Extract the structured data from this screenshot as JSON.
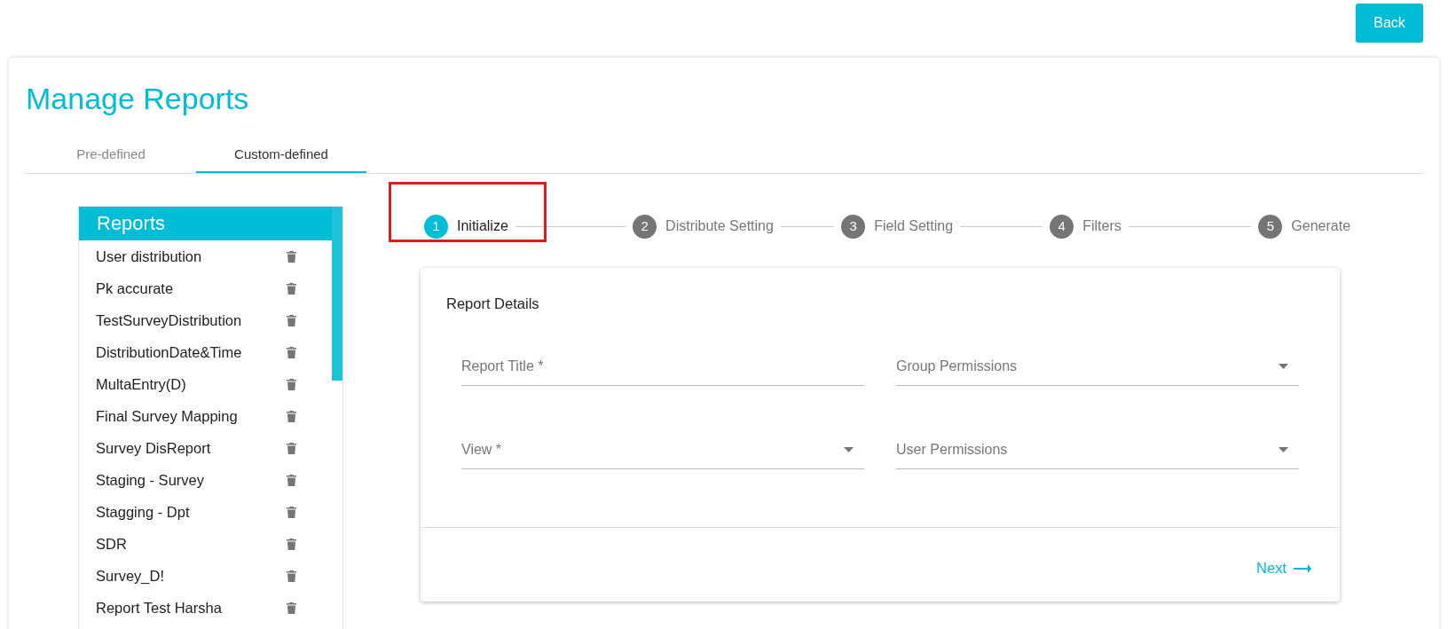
{
  "back_button": "Back",
  "title": "Manage Reports",
  "tabs": [
    {
      "label": "Pre-defined",
      "selected": false
    },
    {
      "label": "Custom-defined",
      "selected": true
    }
  ],
  "reports": {
    "header": "Reports",
    "items": [
      {
        "name": "User distribution"
      },
      {
        "name": "Pk accurate"
      },
      {
        "name": "TestSurveyDistribution"
      },
      {
        "name": "DistributionDate&Time"
      },
      {
        "name": "MultaEntry(D)"
      },
      {
        "name": "Final Survey Mapping"
      },
      {
        "name": "Survey DisReport"
      },
      {
        "name": "Staging - Survey"
      },
      {
        "name": "Stagging - Dpt"
      },
      {
        "name": "SDR"
      },
      {
        "name": "Survey_D!"
      },
      {
        "name": "Report Test Harsha"
      }
    ]
  },
  "steps": [
    {
      "number": "1",
      "label": "Initialize",
      "selected": true,
      "highlighted": true
    },
    {
      "number": "2",
      "label": "Distribute Setting",
      "selected": false,
      "highlighted": false
    },
    {
      "number": "3",
      "label": "Field Setting",
      "selected": false,
      "highlighted": false
    },
    {
      "number": "4",
      "label": "Filters",
      "selected": false,
      "highlighted": false
    },
    {
      "number": "5",
      "label": "Generate",
      "selected": false,
      "highlighted": false
    }
  ],
  "form": {
    "heading": "Report Details",
    "fields": [
      {
        "kind": "text",
        "placeholder": "Report Title *"
      },
      {
        "kind": "select",
        "placeholder": "Group Permissions"
      },
      {
        "kind": "select",
        "placeholder": "View *"
      },
      {
        "kind": "select",
        "placeholder": "User Permissions"
      }
    ],
    "next_button": "Next"
  }
}
